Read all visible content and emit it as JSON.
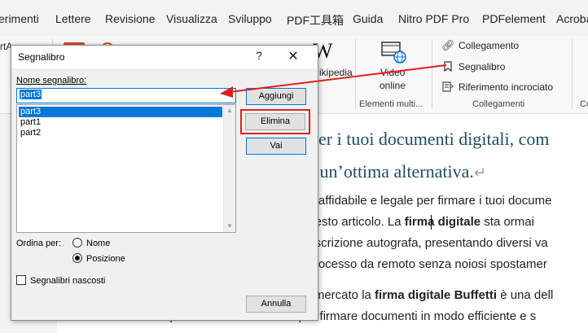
{
  "ribbon_tabs": [
    "erimenti",
    "Lettere",
    "Revisione",
    "Visualizza",
    "Sviluppo",
    "PDF工具箱",
    "Guida",
    "Nitro PDF Pro",
    "PDFelement",
    "Acroba"
  ],
  "ribbon": {
    "partial_left_label": "rtA",
    "wiki_label": "ikipedia",
    "video_label_1": "Video",
    "video_label_2": "online",
    "group_media": "Elementi multi...",
    "collegamento": "Collegamento",
    "segnalibro": "Segnalibro",
    "riferimento": "Riferimento incrociato",
    "group_links": "Collegamenti",
    "partial_right_group": "Co"
  },
  "document": {
    "heading_line1": "per i tuoi documenti digitali, com",
    "heading_line2": "u un’ottima alternativa.",
    "paragraph_mark": "↵",
    "lines": [
      {
        "pre": "ne affidabile e legale per firmare i tuoi docume",
        "bold": "",
        "post": ""
      },
      {
        "pre": " questo articolo. La ",
        "bold": "firma digitale",
        "post": " sta ormai"
      },
      {
        "pre": "ttoscrizione autografa, presentando diversi va",
        "bold": "",
        "post": ""
      },
      {
        "pre": "l processo da remoto senza noiosi spostamer",
        "bold": "",
        "post": ""
      },
      {
        "pre": "ul mercato la ",
        "bold": "firma digitale Buffetti",
        "post": " è una dell"
      },
      {
        "pre": "soluzioni più affidabili e utilizzate per firmare documenti in modo efficiente e s",
        "bold": "",
        "post": ""
      }
    ]
  },
  "dialog": {
    "title": "Segnalibro",
    "help": "?",
    "close": "✕",
    "name_label": "Nome segnalibro:",
    "name_value": "part3",
    "bookmarks": [
      "part3",
      "part1",
      "part2"
    ],
    "selected_index": 0,
    "buttons": {
      "add": "Aggiungi",
      "delete": "Elimina",
      "goto": "Vai",
      "cancel": "Annulla"
    },
    "sort_label": "Ordina per:",
    "sort_options": [
      "Nome",
      "Posizione"
    ],
    "sort_selected": "Posizione",
    "hidden_label": "Segnalibri nascosti",
    "hidden_checked": false
  },
  "colors": {
    "accent": "#0078d7",
    "annotation_red": "#e02020",
    "heading": "#1f4e5f"
  }
}
